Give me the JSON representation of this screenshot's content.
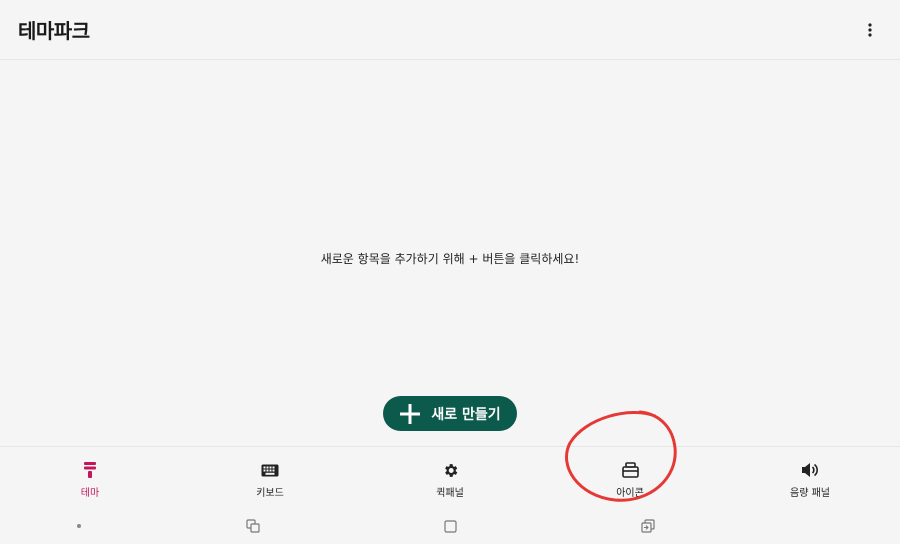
{
  "app_bar": {
    "title": "테마파크",
    "more_icon": "more-vert-icon"
  },
  "main": {
    "empty_message": "새로운 항목을 추가하기 위해 + 버튼을 클릭하세요!"
  },
  "fab": {
    "label": "새로 만들기",
    "icon": "plus-icon",
    "color": "#0b5a4b"
  },
  "bottom_nav": {
    "active_color": "#c2185b",
    "items": [
      {
        "label": "테마",
        "icon": "theme-icon",
        "active": true
      },
      {
        "label": "키보드",
        "icon": "keyboard-icon",
        "active": false
      },
      {
        "label": "퀵패널",
        "icon": "gear-icon",
        "active": false
      },
      {
        "label": "아이콘",
        "icon": "icon-pack-icon",
        "active": false
      },
      {
        "label": "음량 패널",
        "icon": "volume-icon",
        "active": false
      }
    ]
  },
  "system_nav": [
    "dot-icon",
    "recent-apps-icon",
    "home-square-icon",
    "switch-app-icon"
  ],
  "annotation": {
    "color": "#e53935",
    "target": "아이콘"
  }
}
